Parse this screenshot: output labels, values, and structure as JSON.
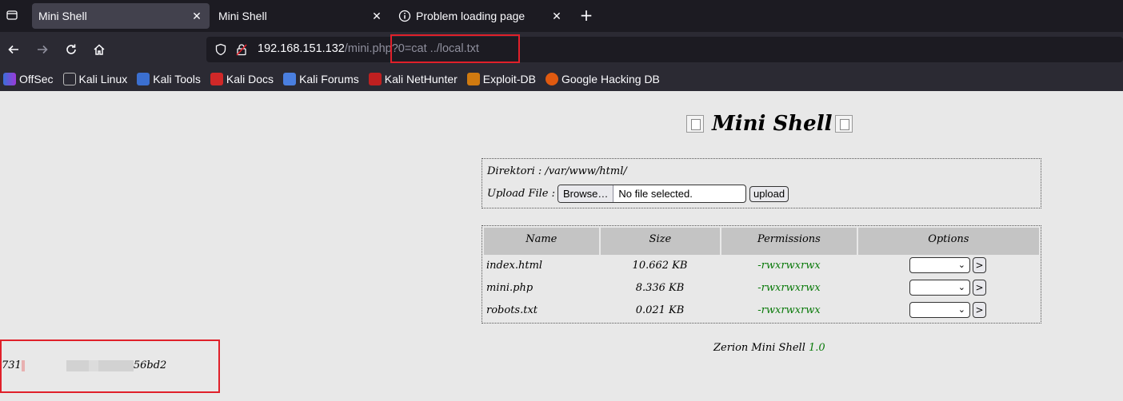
{
  "browser": {
    "tabs": [
      {
        "label": "Mini Shell",
        "close": "✕",
        "active": true
      },
      {
        "label": "Mini Shell",
        "close": "✕",
        "active": false
      },
      {
        "label": "Problem loading page",
        "close": "✕",
        "active": false
      }
    ],
    "new_tab": "+",
    "url_host": "192.168.151.132",
    "url_rest": "/mini.php?0=cat ../local.txt",
    "bookmarks": [
      "OffSec",
      "Kali Linux",
      "Kali Tools",
      "Kali Docs",
      "Kali Forums",
      "Kali NetHunter",
      "Exploit-DB",
      "Google Hacking DB"
    ],
    "accent": "#e0202a"
  },
  "page": {
    "title": "Mini Shell",
    "dir_label": "Direktori : /var/www/html/",
    "upload_label": "Upload File :",
    "browse_label": "Browse…",
    "no_file": "No file selected.",
    "upload_button": "upload",
    "columns": [
      "Name",
      "Size",
      "Permissions",
      "Options"
    ],
    "files": [
      {
        "name": "index.html",
        "size": "10.662 KB",
        "perm": "-rwxrwxrwx"
      },
      {
        "name": "mini.php",
        "size": "8.336 KB",
        "perm": "-rwxrwxrwx"
      },
      {
        "name": "robots.txt",
        "size": "0.021 KB",
        "perm": "-rwxrwxrwx"
      }
    ],
    "go_label": ">",
    "footer_text": "Zerion Mini Shell",
    "footer_version": "1.0",
    "output_prefix": "731",
    "output_suffix": "56bd2"
  }
}
